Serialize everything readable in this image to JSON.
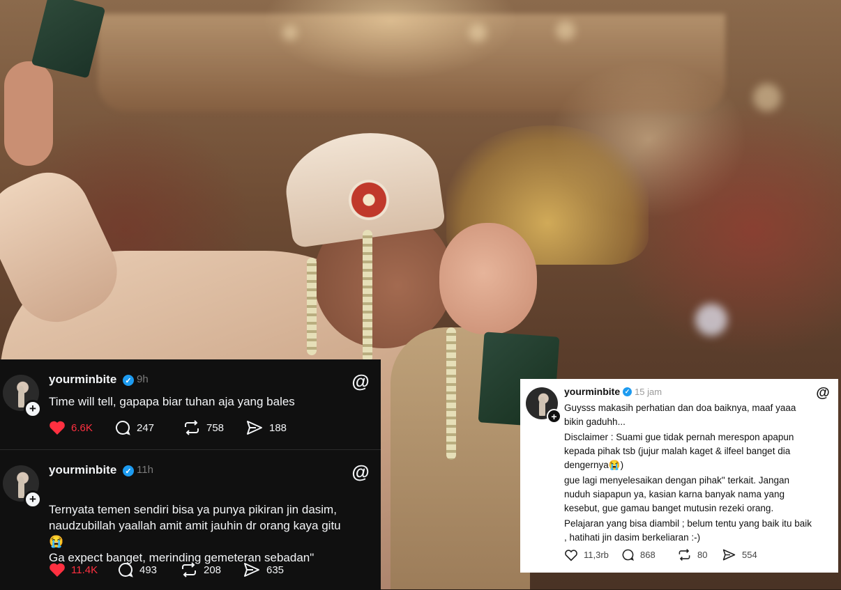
{
  "posts": [
    {
      "username": "yourminbite",
      "time": "9h",
      "text_lines": [
        "Time will tell, gapapa biar tuhan aja yang bales"
      ],
      "likes": "6.6K",
      "comments": "247",
      "reposts": "758",
      "shares": "188",
      "liked": true
    },
    {
      "username": "yourminbite",
      "time": "11h",
      "text_lines": [
        "Ternyata temen sendiri bisa ya punya pikiran jin dasim,",
        "naudzubillah yaallah amit amit jauhin dr orang kaya gitu",
        "😭",
        "Ga expect banget, merinding gemeteran sebadan\""
      ],
      "likes": "11.4K",
      "comments": "493",
      "reposts": "208",
      "shares": "635",
      "liked": true
    },
    {
      "username": "yourminbite",
      "time": "15 jam",
      "text_lines": [
        "Guysss makasih perhatian dan doa baiknya, maaf yaaa",
        "bikin gaduhh...",
        "Disclaimer : Suami gue tidak pernah merespon apapun",
        "kepada pihak tsb (jujur malah kaget & ilfeel banget dia",
        "dengernya😭)",
        "gue lagi menyelesaikan dengan pihak\" terkait. Jangan",
        "nuduh siapapun ya, kasian karna banyak nama yang",
        "kesebut, gue gamau banget mutusin rezeki orang.",
        "Pelajaran yang bisa diambil ; belum tentu yang baik itu baik",
        ", hatihati jin dasim berkeliaran :-)"
      ],
      "likes": "11,3rb",
      "comments": "868",
      "reposts": "80",
      "shares": "554",
      "liked": false
    }
  ],
  "icons": {
    "verified": "✓",
    "plus": "+",
    "threads": "@"
  },
  "colors": {
    "dark_bg": "#101010",
    "like_red": "#ff3040",
    "verified_blue": "#1d9bf0",
    "light_bg": "#ffffff"
  }
}
